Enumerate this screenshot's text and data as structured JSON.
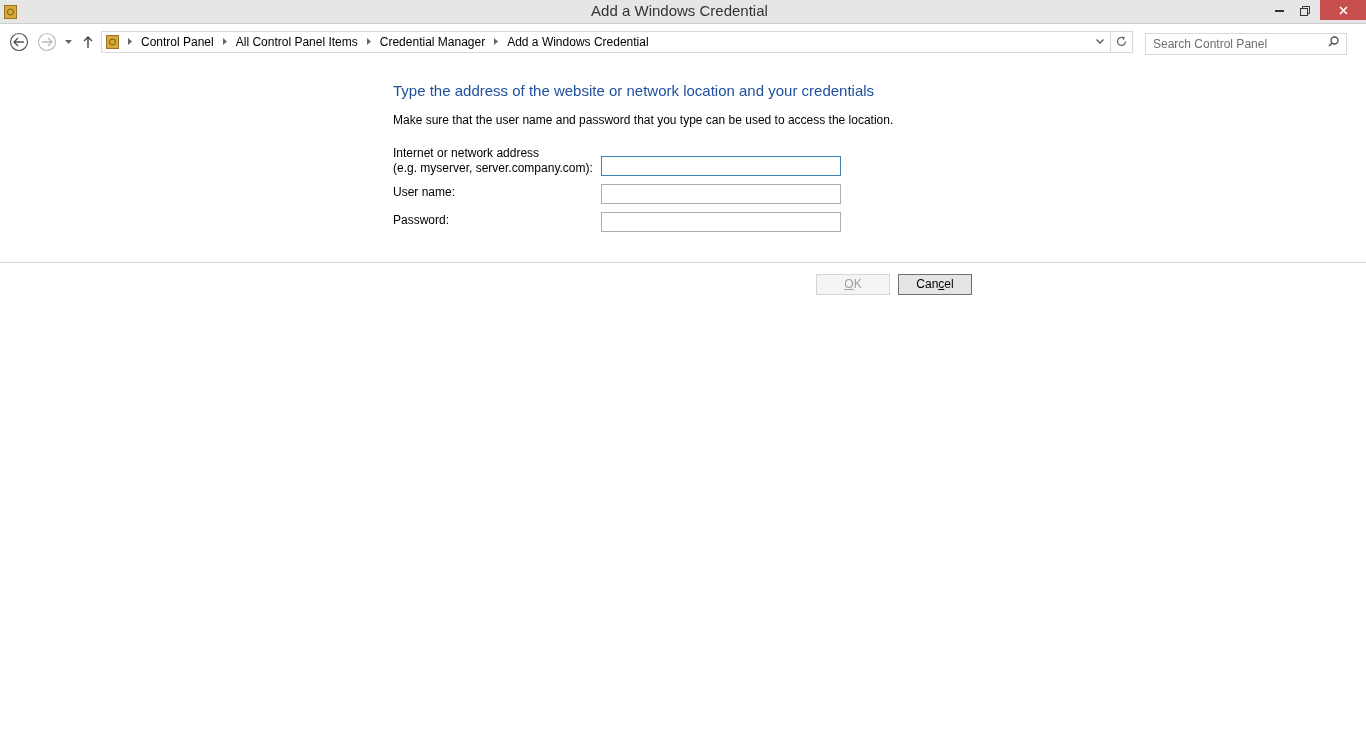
{
  "window": {
    "title": "Add a Windows Credential"
  },
  "address_bar": {
    "breadcrumbs": [
      "Control Panel",
      "All Control Panel Items",
      "Credential Manager",
      "Add a Windows Credential"
    ]
  },
  "nav": {
    "back_disabled": false,
    "forward_disabled": true
  },
  "search": {
    "placeholder": "Search Control Panel"
  },
  "heading": "Type the address of the website or network location and your credentials",
  "description": "Make sure that the user name and password that you type can be used to access the location.",
  "fields": [
    {
      "label_lines": [
        "Internet or network address",
        "(e.g. myserver, server.company.com):"
      ],
      "focused": true
    },
    {
      "label_lines": [
        "User name:"
      ],
      "focused": false
    },
    {
      "label_lines": [
        "Password:"
      ],
      "focused": false
    }
  ],
  "buttons": [
    {
      "label_parts": [
        {
          "text": "O",
          "underlined": true
        },
        {
          "text": "K",
          "underlined": false
        }
      ],
      "disabled": true
    },
    {
      "label_parts": [
        {
          "text": "Can",
          "underlined": false
        },
        {
          "text": "c",
          "underlined": true
        },
        {
          "text": "el",
          "underlined": false
        }
      ],
      "disabled": false
    }
  ]
}
